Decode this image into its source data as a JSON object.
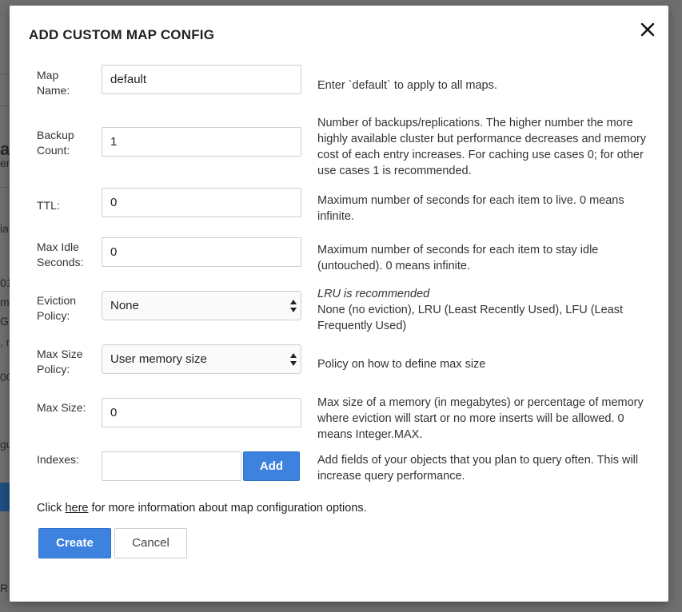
{
  "background": {
    "fragments": [
      "a",
      "er",
      "ia",
      "01",
      "m",
      "G",
      ", r",
      "00",
      "gu",
      "R"
    ]
  },
  "modal": {
    "title": "ADD CUSTOM MAP CONFIG",
    "close_icon": "close-icon"
  },
  "fields": {
    "map_name": {
      "label": "Map Name:",
      "value": "default",
      "help": "Enter `default` to apply to all maps."
    },
    "backup_count": {
      "label": "Backup Count:",
      "value": "1",
      "help": "Number of backups/replications. The higher number the more highly available cluster but performance decreases and memory cost of each entry increases. For caching use cases 0; for other use cases 1 is recommended."
    },
    "ttl": {
      "label": "TTL:",
      "value": "0",
      "help": "Maximum number of seconds for each item to live. 0 means infinite."
    },
    "max_idle": {
      "label": "Max Idle Seconds:",
      "value": "0",
      "help": "Maximum number of seconds for each item to stay idle (untouched). 0 means infinite."
    },
    "eviction_policy": {
      "label": "Eviction Policy:",
      "selected": "None",
      "help_em": "LRU is recommended",
      "help": "None (no eviction), LRU (Least Recently Used), LFU (Least Frequently Used)"
    },
    "max_size_policy": {
      "label": "Max Size Policy:",
      "selected": "User memory size",
      "help": "Policy on how to define max size"
    },
    "max_size": {
      "label": "Max Size:",
      "value": "0",
      "help": "Max size of a memory (in megabytes) or percentage of memory where eviction will start or no more inserts will be allowed. 0 means Integer.MAX."
    },
    "indexes": {
      "label": "Indexes:",
      "value": "",
      "add_label": "Add",
      "help": "Add fields of your objects that you plan to query often. This will increase query performance."
    }
  },
  "info": {
    "prefix": "Click ",
    "link": "here",
    "suffix": " for more information about map configuration options."
  },
  "buttons": {
    "create": "Create",
    "cancel": "Cancel"
  },
  "colors": {
    "primary": "#3d82de",
    "overlay": "#6f6f6f"
  }
}
